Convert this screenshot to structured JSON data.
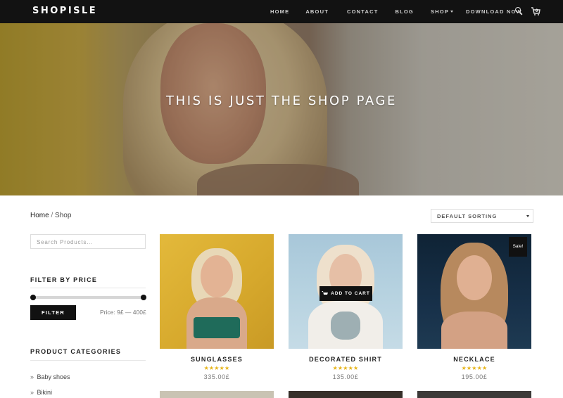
{
  "brand": "SHOPISLE",
  "nav": {
    "home": "HOME",
    "about": "ABOUT",
    "contact": "CONTACT",
    "blog": "BLOG",
    "shop": "SHOP",
    "download": "DOWNLOAD NOW",
    "cart_count": "0"
  },
  "hero": {
    "title": "THIS IS JUST THE SHOP PAGE"
  },
  "breadcrumb": {
    "home": "Home",
    "separator": " / ",
    "current": "Shop"
  },
  "sort": {
    "selected": "DEFAULT SORTING"
  },
  "sidebar": {
    "search_placeholder": "Search Products…",
    "price_title": "FILTER BY PRICE",
    "filter_button": "FILTER",
    "price_label": "Price: 9£ — 400£",
    "categories_title": "PRODUCT CATEGORIES",
    "categories": [
      {
        "label": "Baby shoes"
      },
      {
        "label": "Bikini"
      }
    ]
  },
  "products": [
    {
      "name": "SUNGLASSES",
      "stars": "★★★★★",
      "price": "335.00£"
    },
    {
      "name": "DECORATED SHIRT",
      "stars": "★★★★★",
      "price": "135.00£",
      "hover_action": "ADD TO CART"
    },
    {
      "name": "NECKLACE",
      "stars": "★★★★★",
      "price": "195.00£",
      "badge": "Sale!"
    }
  ],
  "colors": {
    "navbar": "#121212",
    "star": "#e6b419",
    "accent_dark": "#111111"
  }
}
